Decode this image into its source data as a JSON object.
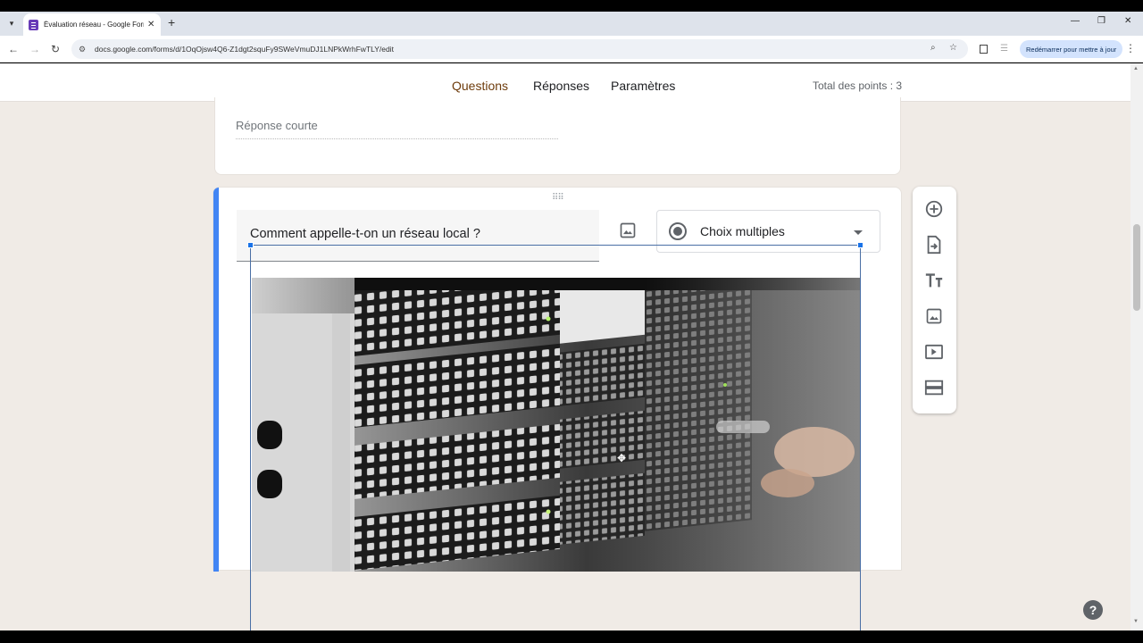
{
  "browser": {
    "tab_title": "Évaluation réseau - Google Forms",
    "new_tab": "+",
    "url": "docs.google.com/forms/d/1OqOjsw4Q6-Z1dgt2squFy9SWeVmuDJ1LNPkWrhFwTLY/edit",
    "update_button": "Redémarrer pour mettre à jour"
  },
  "form_header": {
    "tabs": [
      "Questions",
      "Réponses",
      "Paramètres"
    ],
    "active_tab": "Questions",
    "total_points": "Total des points : 3"
  },
  "previous_question": {
    "answer_placeholder": "Réponse courte"
  },
  "active_question": {
    "title": "Comment appelle-t-on un réseau local ?",
    "type": "Choix multiples"
  },
  "floating_toolbar": {
    "icons": [
      "add-question-icon",
      "import-questions-icon",
      "add-title-icon",
      "add-image-icon",
      "add-video-icon",
      "add-section-icon"
    ]
  },
  "colors": {
    "accent": "#4285f4",
    "tab_active": "#8b4a12",
    "page_bg": "#f0ebe6"
  }
}
